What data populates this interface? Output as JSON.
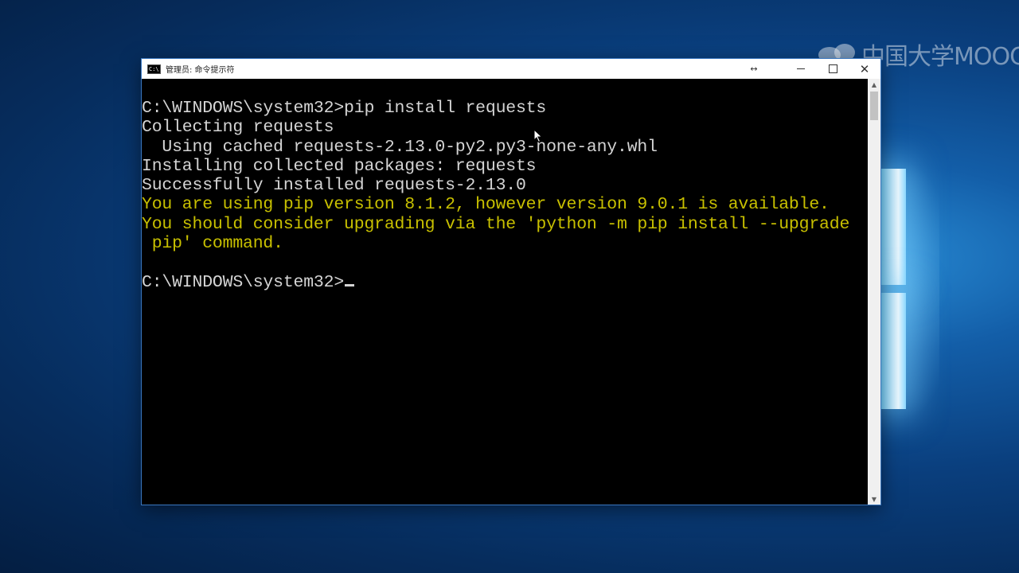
{
  "window": {
    "title": "管理员: 命令提示符",
    "icon": "cmd-icon",
    "controls": {
      "resize_icon": "resize-arrows-icon",
      "minimize_icon": "minimize-icon",
      "maximize_icon": "maximize-icon",
      "close_glyph": "✕"
    }
  },
  "console": {
    "lines": [
      {
        "text": "C:\\WINDOWS\\system32>pip install requests",
        "color": "#d4d4d4"
      },
      {
        "text": "Collecting requests",
        "color": "#d4d4d4"
      },
      {
        "text": "  Using cached requests-2.13.0-py2.py3-none-any.whl",
        "color": "#d4d4d4"
      },
      {
        "text": "Installing collected packages: requests",
        "color": "#d4d4d4"
      },
      {
        "text": "Successfully installed requests-2.13.0",
        "color": "#d4d4d4"
      },
      {
        "text": "You are using pip version 8.1.2, however version 9.0.1 is available.",
        "color": "#c8c000"
      },
      {
        "text": "You should consider upgrading via the 'python -m pip install --upgrade",
        "color": "#c8c000"
      },
      {
        "text": " pip' command.",
        "color": "#c8c000"
      },
      {
        "text": "",
        "color": "#d4d4d4"
      },
      {
        "text": "C:\\WINDOWS\\system32>",
        "color": "#d4d4d4"
      }
    ]
  },
  "desktop": {
    "watermark_text": "中国大学MOOC"
  },
  "colors": {
    "console_bg": "#000000",
    "console_fg": "#d4d4d4",
    "warning": "#c8c000",
    "titlebar_bg": "#ffffff"
  }
}
